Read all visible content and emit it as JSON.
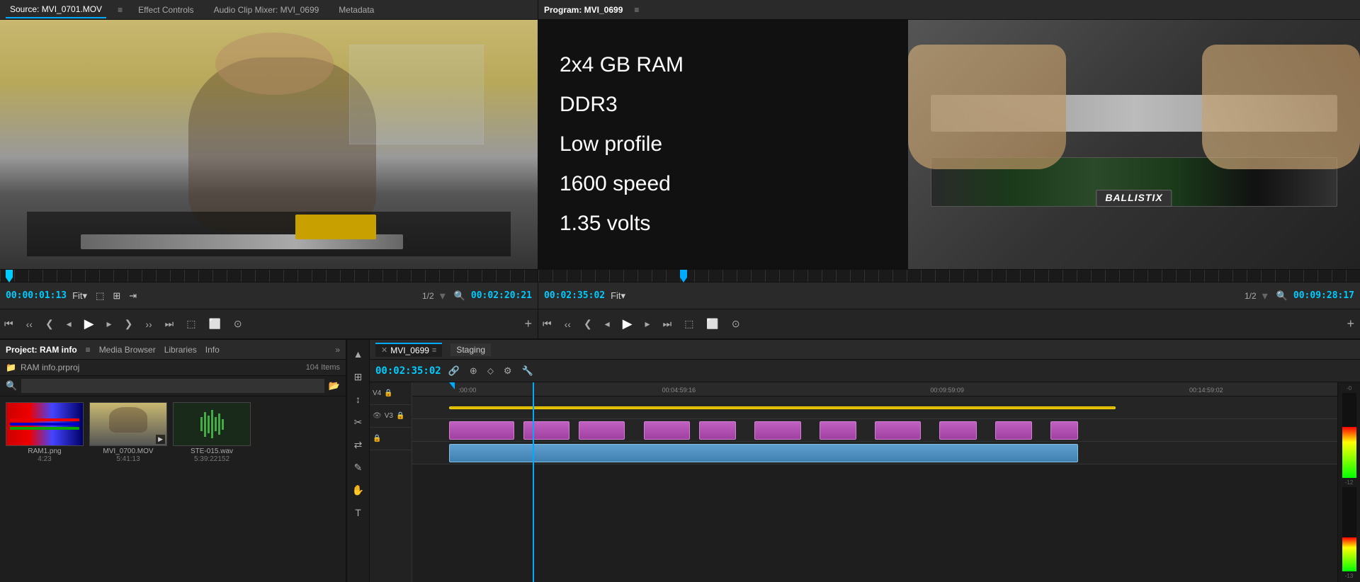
{
  "source": {
    "tabs": [
      {
        "label": "Source: MVI_0701.MOV",
        "active": true
      },
      {
        "label": "Effect Controls",
        "active": false
      },
      {
        "label": "Audio Clip Mixer: MVI_0699",
        "active": false
      },
      {
        "label": "Metadata",
        "active": false
      }
    ],
    "timecode": "00:00:01:13",
    "fit": "Fit",
    "fraction": "1/2",
    "end_timecode": "00:02:20:21",
    "menu_icon": "≡"
  },
  "program": {
    "title": "Program: MVI_0699",
    "menu_icon": "≡",
    "timecode": "00:02:35:02",
    "fit": "Fit",
    "fraction": "1/2",
    "end_timecode": "00:09:28:17",
    "overlay_lines": [
      "2x4 GB RAM",
      "DDR3",
      "Low profile",
      "1600 speed",
      "1.35 volts"
    ]
  },
  "project": {
    "title": "Project: RAM info",
    "menu_icon": "≡",
    "tabs": [
      {
        "label": "Project: RAM info",
        "active": true
      },
      {
        "label": "Media Browser"
      },
      {
        "label": "Libraries"
      },
      {
        "label": "Info"
      }
    ],
    "expand_icon": "»",
    "path": "RAM info.prproj",
    "item_count": "104 Items",
    "search_placeholder": "",
    "items": [
      {
        "name": "RAM1.png",
        "duration": "4:23",
        "type": "image"
      },
      {
        "name": "MVI_0700.MOV",
        "duration": "5:41:13",
        "type": "video"
      },
      {
        "name": "STE-015.wav",
        "duration": "5:39:22152",
        "type": "audio"
      }
    ]
  },
  "timeline": {
    "tab_label": "MVI_0699",
    "staging_label": "Staging",
    "timecode": "00:02:35:02",
    "rulers": [
      {
        "label": ":00:00",
        "pos_pct": 5
      },
      {
        "label": "00:04:59:16",
        "pos_pct": 28
      },
      {
        "label": "00:09:59:09",
        "pos_pct": 58
      },
      {
        "label": "00:14:59:02",
        "pos_pct": 87
      }
    ],
    "tracks": [
      {
        "name": "V4",
        "clips": []
      },
      {
        "name": "V3",
        "clips": [
          {
            "left_pct": 4,
            "width_pct": 8,
            "type": "video"
          },
          {
            "left_pct": 14,
            "width_pct": 5,
            "type": "video"
          },
          {
            "left_pct": 22,
            "width_pct": 6,
            "type": "video"
          },
          {
            "left_pct": 32,
            "width_pct": 4,
            "type": "video"
          },
          {
            "left_pct": 39,
            "width_pct": 5,
            "type": "video"
          },
          {
            "left_pct": 48,
            "width_pct": 6,
            "type": "video"
          },
          {
            "left_pct": 57,
            "width_pct": 4,
            "type": "video"
          },
          {
            "left_pct": 64,
            "width_pct": 5,
            "type": "video"
          },
          {
            "left_pct": 72,
            "width_pct": 4,
            "type": "video"
          }
        ]
      }
    ],
    "playhead_pct": 13,
    "toolbar": {
      "wrench_icon": "🔧",
      "scissors_icon": "✂",
      "ripple_icon": "↕",
      "slip_icon": "⇄",
      "pen_icon": "✎",
      "hand_icon": "☛"
    }
  },
  "transport_source": {
    "buttons": [
      "⏮",
      "‹",
      "❮|",
      "◂",
      "▶",
      "▸",
      "|❯",
      "›",
      "⏭",
      "⬚",
      "⬜",
      "⊙"
    ],
    "plus": "+"
  },
  "transport_program": {
    "buttons": [
      "⏮",
      "‹",
      "❮|",
      "◂",
      "▶",
      "▸",
      "⏭",
      "⬚",
      "⬜",
      "⊙"
    ],
    "plus": "+"
  },
  "audio_meter": {
    "labels": [
      "-0",
      "-12",
      "-13"
    ]
  }
}
